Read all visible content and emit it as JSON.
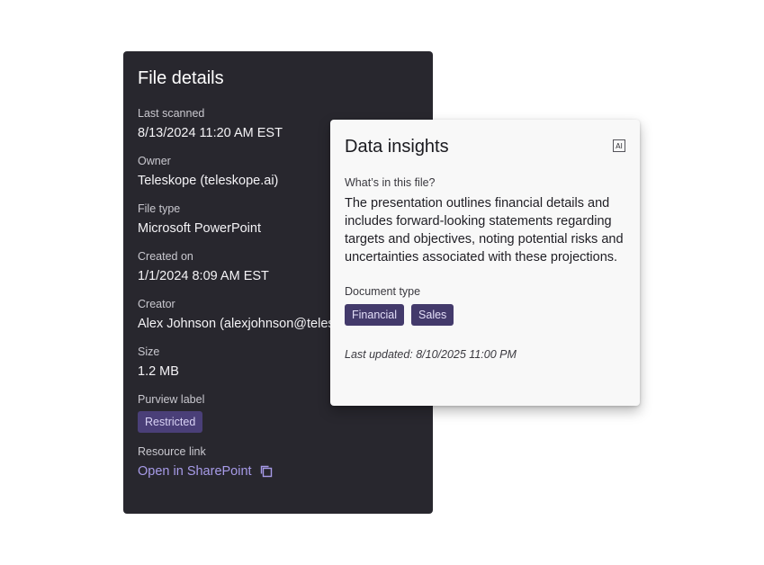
{
  "file_details": {
    "title": "File details",
    "last_scanned_label": "Last scanned",
    "last_scanned_value": "8/13/2024 11:20 AM EST",
    "owner_label": "Owner",
    "owner_value": "Teleskope (teleskope.ai)",
    "file_type_label": "File type",
    "file_type_value": "Microsoft PowerPoint",
    "created_on_label": "Created on",
    "created_on_value": "1/1/2024 8:09 AM EST",
    "creator_label": "Creator",
    "creator_value": "Alex Johnson (alexjohnson@teleskope.ai)",
    "size_label": "Size",
    "size_value": "1.2 MB",
    "purview_label": "Purview label",
    "purview_value": "Restricted",
    "resource_link_label": "Resource link",
    "resource_link_text": "Open in SharePoint"
  },
  "data_insights": {
    "title": "Data insights",
    "ai_badge": "AI",
    "whats_in_label": "What’s in this file?",
    "description": "The presentation outlines financial details and includes forward-looking statements regarding targets and objectives, noting potential risks and uncertainties associated with these projections.",
    "doc_type_label": "Document type",
    "tags": [
      "Financial",
      "Sales"
    ],
    "last_updated": "Last updated: 8/10/2025 11:00 PM"
  },
  "colors": {
    "dark_card_bg": "#28272e",
    "accent_link": "#a79be8",
    "tag_bg": "#433a6b"
  }
}
